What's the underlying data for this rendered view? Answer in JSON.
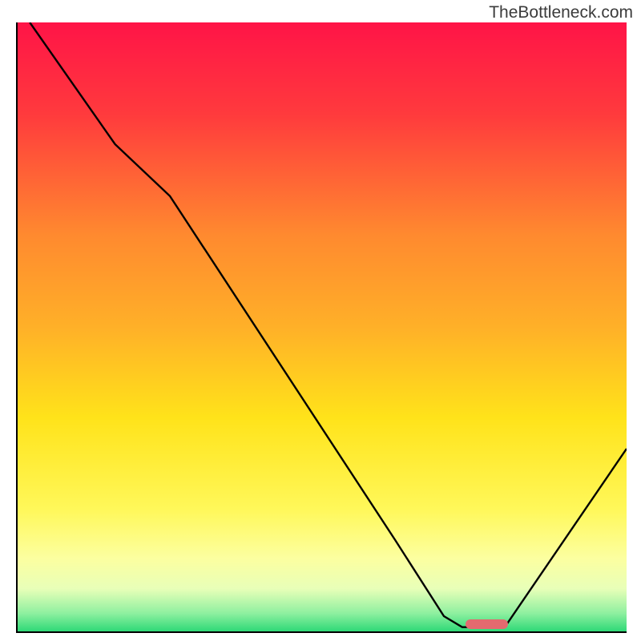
{
  "watermark": "TheBottleneck.com",
  "chart_data": {
    "type": "line",
    "title": "",
    "xlabel": "",
    "ylabel": "",
    "xlim": [
      0,
      100
    ],
    "ylim": [
      0,
      100
    ],
    "grid": false,
    "legend": false,
    "gradient_stops": [
      {
        "pos": 0.0,
        "color": "#ff1447"
      },
      {
        "pos": 0.15,
        "color": "#ff3a3d"
      },
      {
        "pos": 0.35,
        "color": "#ff8a2f"
      },
      {
        "pos": 0.5,
        "color": "#ffb028"
      },
      {
        "pos": 0.65,
        "color": "#ffe31a"
      },
      {
        "pos": 0.8,
        "color": "#fff85a"
      },
      {
        "pos": 0.88,
        "color": "#fcffa0"
      },
      {
        "pos": 0.93,
        "color": "#e8ffb8"
      },
      {
        "pos": 0.97,
        "color": "#8ff0a0"
      },
      {
        "pos": 1.0,
        "color": "#2fd977"
      }
    ],
    "series": [
      {
        "name": "bottleneck-curve",
        "points_pct": [
          {
            "x": 2.0,
            "y": 100.0
          },
          {
            "x": 16.0,
            "y": 80.0
          },
          {
            "x": 25.0,
            "y": 71.5
          },
          {
            "x": 62.0,
            "y": 15.0
          },
          {
            "x": 70.0,
            "y": 2.5
          },
          {
            "x": 73.0,
            "y": 0.7
          },
          {
            "x": 80.0,
            "y": 0.7
          },
          {
            "x": 100.0,
            "y": 30.0
          }
        ]
      }
    ],
    "marker": {
      "name": "optimal-range",
      "x_pct": 73.5,
      "width_pct": 7.0,
      "y_pct": 1.2,
      "color": "#e46a6f"
    }
  }
}
